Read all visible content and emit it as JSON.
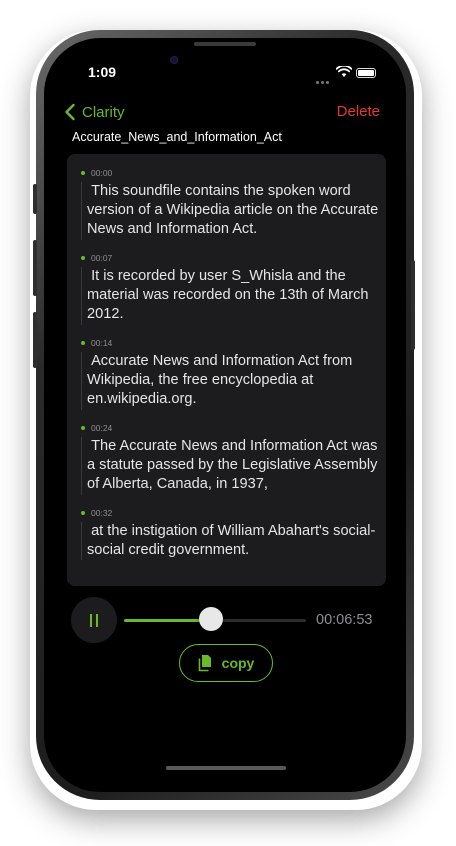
{
  "status_bar": {
    "time": "1:09"
  },
  "nav": {
    "back_label": "Clarity",
    "delete_label": "Delete"
  },
  "file": {
    "title": "Accurate_News_and_Information_Act"
  },
  "transcript": {
    "segments": [
      {
        "time": "00:00",
        "text": " This soundfile contains the spoken word version of a Wikipedia article on the Accurate News and Information Act."
      },
      {
        "time": "00:07",
        "text": " It is recorded by user S_Whisla and the material was recorded on the 13th of March 2012."
      },
      {
        "time": "00:14",
        "text": " Accurate News and Information Act from Wikipedia, the free encyclopedia at en.wikipedia.org."
      },
      {
        "time": "00:24",
        "text": " The Accurate News and Information Act was a statute passed by the Legislative Assembly of Alberta, Canada, in 1937,"
      },
      {
        "time": "00:32",
        "text": " at the instigation of William Abahart's social-social credit government."
      }
    ]
  },
  "player": {
    "state": "playing",
    "progress": 0.48,
    "duration": "00:06:53"
  },
  "actions": {
    "copy_label": "copy"
  },
  "colors": {
    "accent": "#6ab82b",
    "destructive": "#e23a2e",
    "card": "#1c1c1e",
    "background": "#000000"
  },
  "icons": {
    "back": "chevron-left-icon",
    "pause": "pause-icon",
    "copy": "copy-icon",
    "wifi": "wifi-icon",
    "battery": "battery-icon"
  }
}
